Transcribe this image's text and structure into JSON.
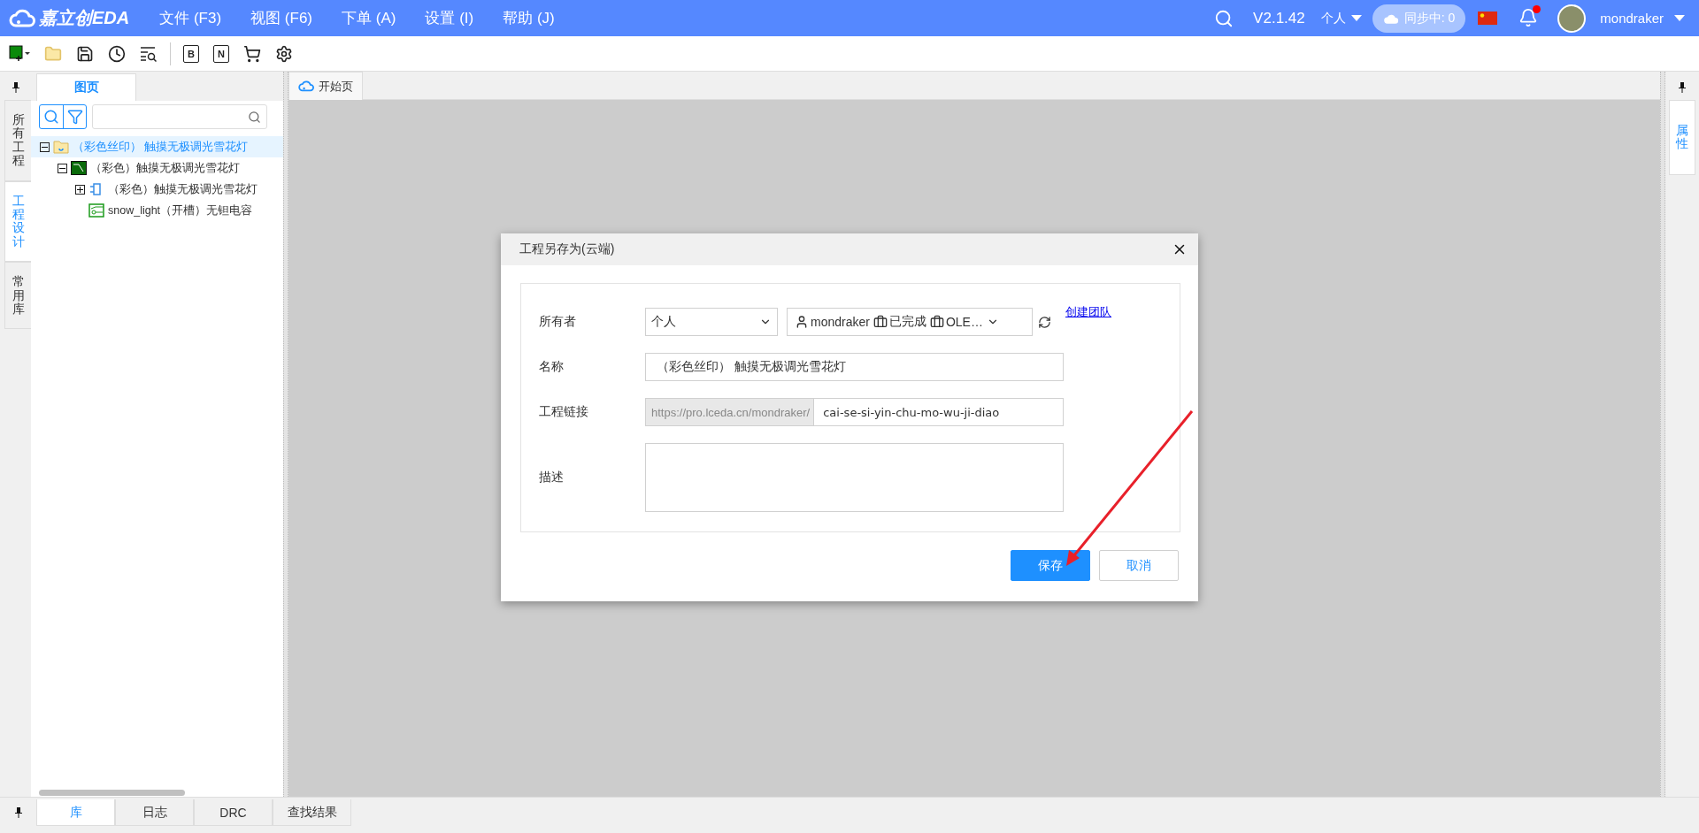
{
  "menu_bar": {
    "logo": "嘉立创EDA",
    "menus": [
      "文件 (F3)",
      "视图 (F6)",
      "下单 (A)",
      "设置 (I)",
      "帮助 (J)"
    ],
    "version": "V2.1.42",
    "account": "个人",
    "sync": "同步中: 0",
    "notification_unread": true,
    "user": "mondraker"
  },
  "toolbar": [
    {
      "kind": "new"
    },
    {
      "kind": "folder"
    },
    {
      "kind": "save"
    },
    {
      "kind": "history"
    },
    {
      "kind": "find"
    },
    {
      "kind": "separator"
    },
    {
      "kind": "letter",
      "glyph": "B"
    },
    {
      "kind": "letter",
      "glyph": "N"
    },
    {
      "kind": "cart"
    },
    {
      "kind": "settings"
    }
  ],
  "left_tabs": [
    {
      "label": "所有工程",
      "selected": false
    },
    {
      "label": "工程设计",
      "selected": true
    },
    {
      "label": "常用库",
      "selected": false
    }
  ],
  "panel": {
    "tab": "图页",
    "tree": [
      {
        "label": "（彩色丝印） 触摸无极调光雪花灯",
        "kind": "project",
        "expanded": true,
        "selected": true,
        "children": [
          {
            "label": "（彩色）触摸无极调光雪花灯",
            "kind": "board",
            "expanded": true,
            "selected": false,
            "children": [
              {
                "label": "（彩色）触摸无极调光雪花灯",
                "kind": "schematic",
                "expanded": false,
                "selected": false
              },
              {
                "label": "snow_light（开槽）无钽电容",
                "kind": "pcb",
                "selected": false
              }
            ]
          }
        ]
      }
    ]
  },
  "center_tabs": [
    {
      "label": "开始页",
      "selected": true
    }
  ],
  "right_tabs": [
    {
      "label": "属性",
      "selected": true
    }
  ],
  "bottom_tabs": [
    {
      "label": "库",
      "selected": true
    },
    {
      "label": "日志",
      "selected": false
    },
    {
      "label": "DRC",
      "selected": false
    },
    {
      "label": "查找结果",
      "selected": false
    }
  ],
  "dialog": {
    "title": "工程另存为(云端)",
    "owner_label": "所有者",
    "owner_value": "个人",
    "team_items": [
      {
        "kind": "user",
        "label": "mondraker"
      },
      {
        "kind": "team",
        "label": "已完成"
      },
      {
        "kind": "team",
        "label": "OLE…"
      }
    ],
    "create_team_link": "创建团队",
    "name_label": "名称",
    "name_value": "（彩色丝印） 触摸无极调光雪花灯",
    "link_label": "工程链接",
    "link_prefix": "https://pro.lceda.cn/mondraker/",
    "link_value": "cai-se-si-yin-chu-mo-wu-ji-diao",
    "description_label": "描述",
    "buttons": [
      {
        "label": "保存",
        "kind": "primary"
      },
      {
        "label": "取消",
        "kind": "secondary"
      }
    ]
  }
}
